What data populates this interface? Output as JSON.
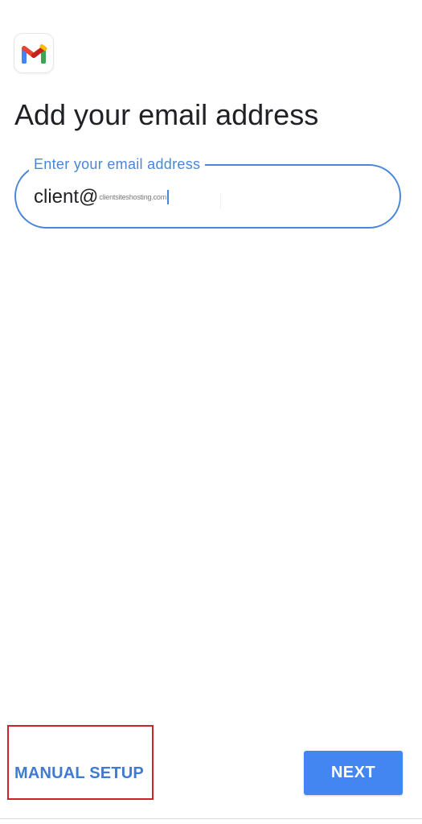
{
  "app": {
    "logo_icon": "gmail-logo-icon"
  },
  "header": {
    "title": "Add your email address"
  },
  "email_field": {
    "label": "Enter your email address",
    "value_local": "client@",
    "value_domain": "clientsiteshosting.com",
    "accent_color": "#4a86d8"
  },
  "actions": {
    "manual_setup_label": "MANUAL SETUP",
    "next_label": "NEXT"
  },
  "annotation": {
    "highlight_color": "#cf1f2e",
    "highlighted_element": "manual-setup-button"
  }
}
